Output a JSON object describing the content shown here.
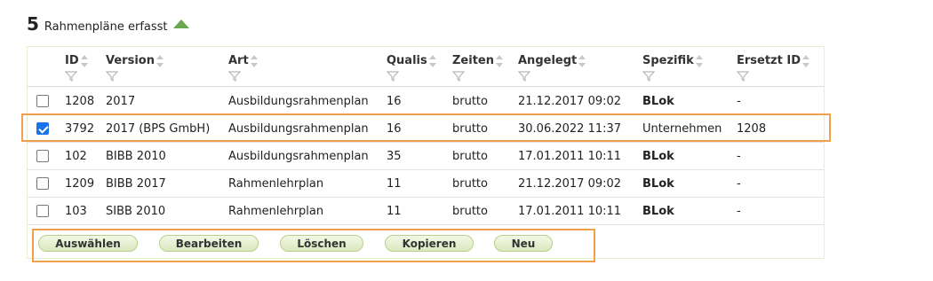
{
  "summary": {
    "count": "5",
    "label": "Rahmenpläne erfasst"
  },
  "columns": [
    "ID",
    "Version",
    "Art",
    "Qualis",
    "Zeiten",
    "Angelegt",
    "Spezifik",
    "Ersetzt ID"
  ],
  "rows": [
    {
      "checked": false,
      "id": "1208",
      "version": "2017",
      "art": "Ausbildungsrahmenplan",
      "qualis": "16",
      "zeiten": "brutto",
      "angelegt": "21.12.2017 09:02",
      "spezifik": "BLok",
      "ersetzt": "-"
    },
    {
      "checked": true,
      "id": "3792",
      "version": "2017 (BPS GmbH)",
      "art": "Ausbildungsrahmenplan",
      "qualis": "16",
      "zeiten": "brutto",
      "angelegt": "30.06.2022 11:37",
      "spezifik": "Unternehmen",
      "ersetzt": "1208"
    },
    {
      "checked": false,
      "id": "102",
      "version": "BIBB 2010",
      "art": "Ausbildungsrahmenplan",
      "qualis": "35",
      "zeiten": "brutto",
      "angelegt": "17.01.2011 10:11",
      "spezifik": "BLok",
      "ersetzt": "-"
    },
    {
      "checked": false,
      "id": "1209",
      "version": "BIBB 2017",
      "art": "Rahmenlehrplan",
      "qualis": "11",
      "zeiten": "brutto",
      "angelegt": "21.12.2017 09:02",
      "spezifik": "BLok",
      "ersetzt": "-"
    },
    {
      "checked": false,
      "id": "103",
      "version": "SIBB 2010",
      "art": "Rahmenlehrplan",
      "qualis": "11",
      "zeiten": "brutto",
      "angelegt": "17.01.2011 10:11",
      "spezifik": "BLok",
      "ersetzt": "-"
    }
  ],
  "buttons": {
    "select": "Auswählen",
    "edit": "Bearbeiten",
    "delete": "Löschen",
    "copy": "Kopieren",
    "new": "Neu"
  },
  "icons": {
    "summary_toggle": "triangle-up-icon",
    "sort": "sort-icon",
    "filter": "filter-funnel-icon"
  },
  "colors": {
    "accent_green": "#6aa84f",
    "highlight_orange": "#f0a04b",
    "checkbox_blue": "#1a73e8"
  }
}
